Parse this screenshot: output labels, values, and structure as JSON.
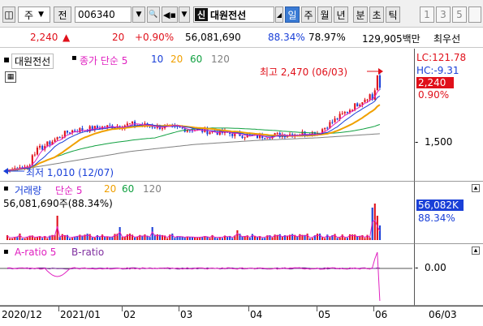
{
  "toolbar": {
    "market": "주",
    "prev_label": "전",
    "code": "006340",
    "name_tag": "신",
    "name": "대원전선",
    "periods": [
      "일",
      "주",
      "월",
      "년"
    ],
    "chart_types": [
      "분",
      "초",
      "틱"
    ],
    "intervals": [
      "1",
      "3",
      "5"
    ]
  },
  "quote": {
    "price": "2,240",
    "change": "20",
    "change_pct": "+0.90%",
    "volume": "56,081,690",
    "vol_ratio": "88.34%",
    "turnover": "78.97%",
    "market_cap": "129,905백만",
    "preferred": "최우선"
  },
  "price_panel": {
    "name": "대원전선",
    "ma_label": "종가 단순 5",
    "ma_periods": [
      "10",
      "20",
      "60",
      "120"
    ],
    "high_note": "최고 2,470 (06/03)",
    "low_note": "최저 1,010 (12/07)",
    "lc": "LC:121.78",
    "hc": "HC:-9.31",
    "last_price": "2,240",
    "last_pct": "0.90%",
    "axis_level": "1,500"
  },
  "volume_panel": {
    "name": "거래량",
    "ma_label": "단순 5",
    "ma_periods": [
      "20",
      "60",
      "120"
    ],
    "value_text": "56,081,690주(88.34%)",
    "axis_value": "56,082K",
    "axis_pct": "88.34%"
  },
  "ratio_panel": {
    "a_label": "A-ratio 5",
    "b_label": "B-ratio",
    "axis_zero": "0.00"
  },
  "x_axis": {
    "labels": [
      "2020/12",
      "2021/01",
      "02",
      "03",
      "04",
      "05",
      "06"
    ],
    "cursor_date": "06/03"
  },
  "colors": {
    "up": "#e0101a",
    "down": "#1a40d8",
    "ma5": "#e020c0",
    "ma10": "#1a40d8",
    "ma20": "#f0a000",
    "ma60": "#10a040",
    "ma120": "#808080",
    "a_ratio": "#e020c0",
    "b_ratio": "#8030a0"
  },
  "chart_data": {
    "type": "line",
    "title": "",
    "x": [
      "2020/12",
      "2021/01",
      "02",
      "03",
      "04",
      "05",
      "06"
    ],
    "series": [
      {
        "name": "종가",
        "values": [
          1050,
          1600,
          1700,
          1620,
          1520,
          1580,
          2240
        ]
      },
      {
        "name": "MA120",
        "values": [
          1000,
          1150,
          1300,
          1400,
          1460,
          1500,
          1560
        ]
      }
    ],
    "ylim": [
      900,
      2600
    ],
    "annotations": [
      "최고 2,470 (06/03)",
      "최저 1,010 (12/07)"
    ]
  }
}
